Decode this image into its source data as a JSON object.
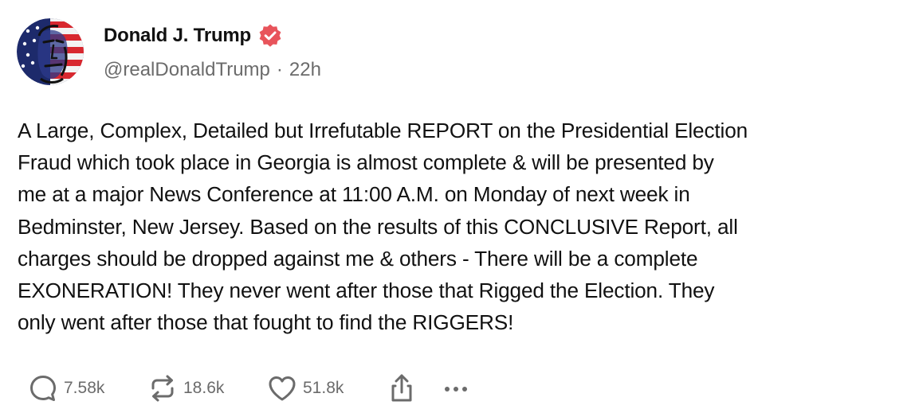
{
  "author": {
    "display_name": "Donald J. Trump",
    "handle": "@realDonaldTrump",
    "separator": "·",
    "timestamp": "22h",
    "verified_icon": "verified-badge-icon",
    "accent_color": "#e8545b"
  },
  "post": {
    "lines": [
      "A Large, Complex, Detailed but Irrefutable REPORT on the Presidential Election",
      "Fraud which took place in Georgia is almost complete & will be presented by",
      "me at a major News Conference at 11:00 A.M. on Monday of next week in",
      "Bedminster, New Jersey. Based on the results of this CONCLUSIVE Report, all",
      "charges should be dropped against me & others - There will be a complete",
      "EXONERATION! They never went after those that Rigged the Election. They",
      "only went after those that fought to find the RIGGERS!"
    ]
  },
  "actions": {
    "reply": {
      "icon": "reply-icon",
      "count": "7.58k"
    },
    "retruth": {
      "icon": "retruth-icon",
      "count": "18.6k"
    },
    "like": {
      "icon": "heart-icon",
      "count": "51.8k"
    },
    "share": {
      "icon": "share-icon"
    },
    "more": {
      "icon": "more-icon"
    }
  }
}
